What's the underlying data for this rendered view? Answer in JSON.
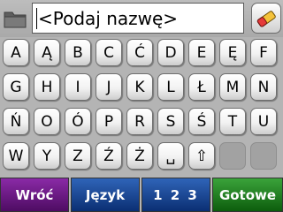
{
  "input": {
    "placeholder": "<Podaj nazwę>"
  },
  "toolbar": {
    "folder_icon": "folder-icon",
    "clear_icon": "eraser-icon"
  },
  "keyboard": {
    "rows": [
      [
        "A",
        "Ą",
        "B",
        "C",
        "Ć",
        "D",
        "E",
        "Ę",
        "F"
      ],
      [
        "G",
        "H",
        "I",
        "J",
        "K",
        "L",
        "Ł",
        "M",
        "N"
      ],
      [
        "Ń",
        "O",
        "Ó",
        "P",
        "R",
        "S",
        "Ś",
        "T",
        "U"
      ],
      [
        "W",
        "Y",
        "Z",
        "Ź",
        "Ż",
        "␣",
        "⇧",
        "",
        ""
      ]
    ]
  },
  "bottom": {
    "back_label": "Wróć",
    "lang_label": "Język",
    "num_label": "1 2 3",
    "done_label": "Gotowe"
  },
  "colors": {
    "background": "#b4b4b4",
    "back": "#6a1b86",
    "lang": "#1c4a98",
    "done": "#237f23"
  }
}
